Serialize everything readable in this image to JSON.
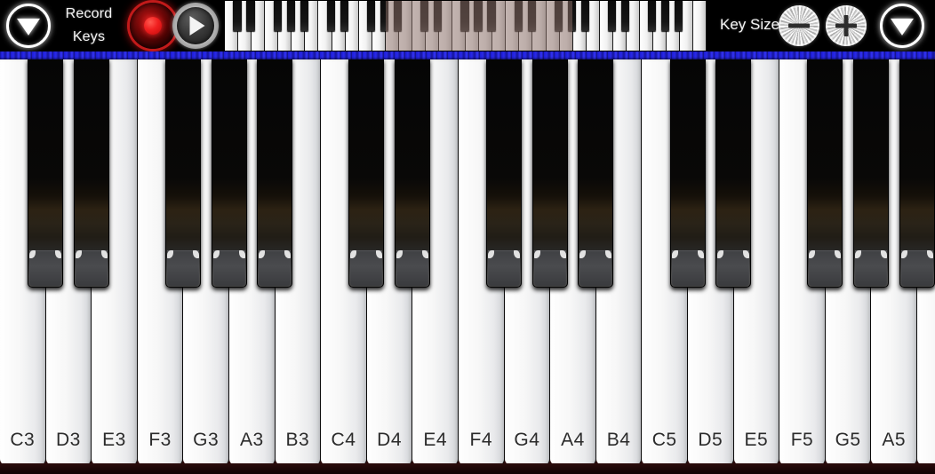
{
  "toolbar": {
    "collapse_left_icon": "chevron-down-triangle-icon",
    "collapse_right_icon": "chevron-down-triangle-icon",
    "record_label_line1": "Record",
    "record_label_line2": "Keys",
    "record_button_icon": "record-dot-icon",
    "play_button_icon": "play-triangle-icon",
    "keysize_label": "Key Size",
    "keysize_minus_label": "−",
    "keysize_plus_label": "+",
    "colors": {
      "toolbar_bg": "#000000",
      "record_red": "#c21a1a",
      "divider_blue": "#2a2ae8",
      "metal_silver": "#ededed",
      "body_maroon": "#2a0b0b"
    }
  },
  "mini_keyboard": {
    "total_white_keys": 36,
    "highlight_start_key_index": 12,
    "highlight_end_key_index": 26,
    "highlight_color": "#8c7068"
  },
  "keyboard": {
    "white_keys": [
      {
        "label": "C3"
      },
      {
        "label": "D3"
      },
      {
        "label": "E3"
      },
      {
        "label": "F3"
      },
      {
        "label": "G3"
      },
      {
        "label": "A3"
      },
      {
        "label": "B3"
      },
      {
        "label": "C4"
      },
      {
        "label": "D4"
      },
      {
        "label": "E4"
      },
      {
        "label": "F4"
      },
      {
        "label": "G4"
      },
      {
        "label": "A4"
      },
      {
        "label": "B4"
      },
      {
        "label": "C5"
      },
      {
        "label": "D5"
      },
      {
        "label": "E5"
      },
      {
        "label": "F5"
      },
      {
        "label": "G5"
      },
      {
        "label": "A5"
      },
      {
        "label": ""
      }
    ],
    "black_key_offsets_after_white_index": [
      0,
      1,
      3,
      4,
      5,
      7,
      8,
      10,
      11,
      12,
      14,
      15,
      17,
      18,
      19
    ]
  }
}
